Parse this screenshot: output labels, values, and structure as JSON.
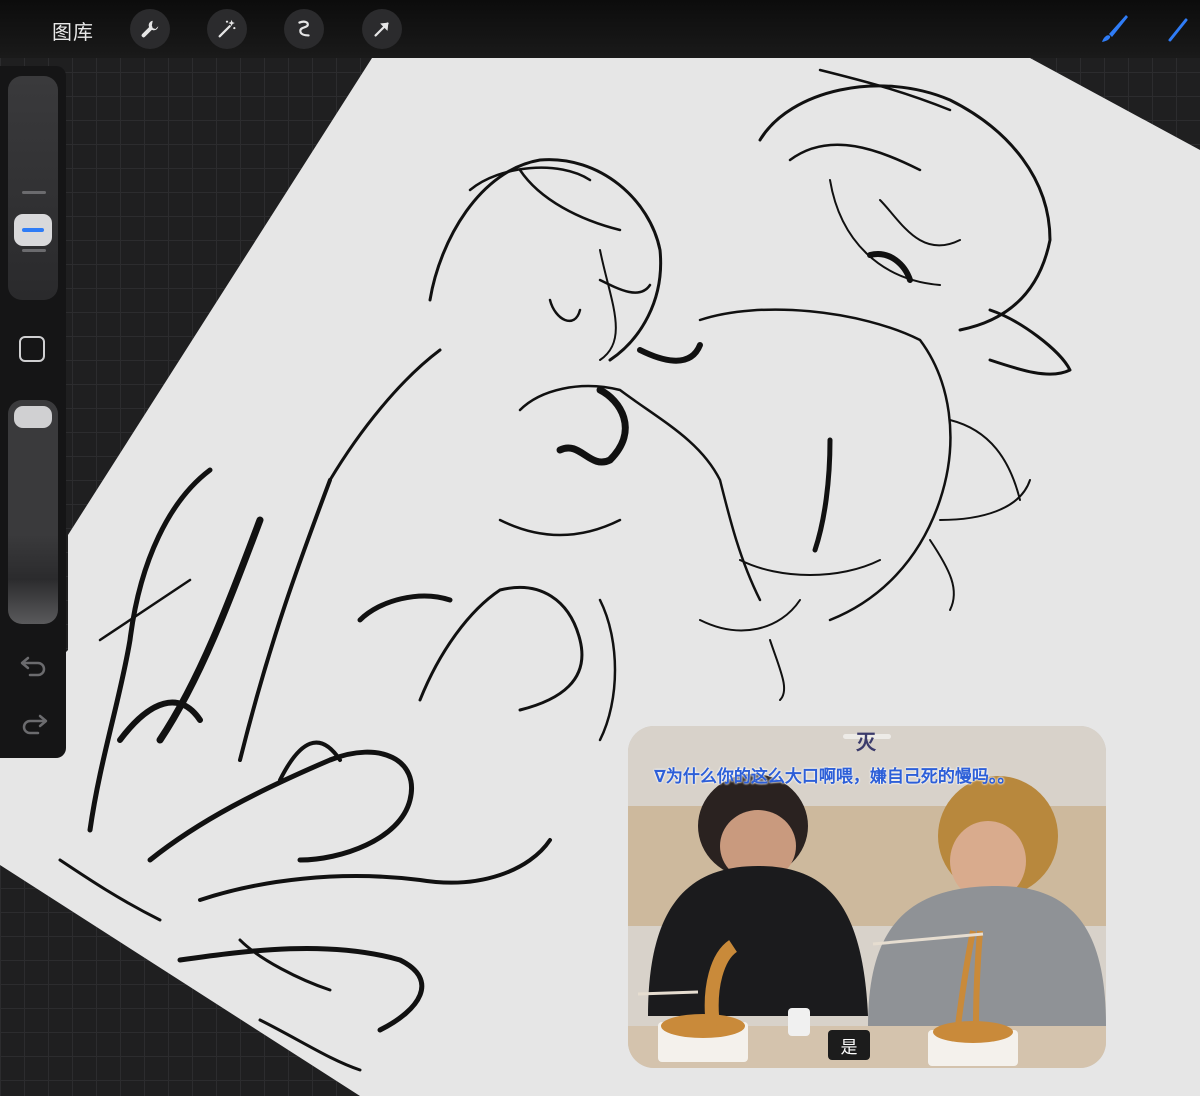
{
  "app": {
    "gallery_label": "图库"
  },
  "toolbar": {
    "tools": [
      {
        "icon": "wrench-icon",
        "name": "actions"
      },
      {
        "icon": "magic-wand-icon",
        "name": "adjustments"
      },
      {
        "icon": "selection-icon",
        "name": "selection"
      },
      {
        "icon": "arrow-icon",
        "name": "transform"
      }
    ],
    "brush_icon": "brush-icon",
    "accent_color": "#2f7cf6"
  },
  "sidebar": {
    "modify_icon": "square-icon",
    "undo_icon": "undo-icon",
    "redo_icon": "redo-icon"
  },
  "pip": {
    "top_char": "灭",
    "subtitle": "∇为什么你的这么大口啊喂，嫌自己死的慢吗。。",
    "chip": "是"
  }
}
